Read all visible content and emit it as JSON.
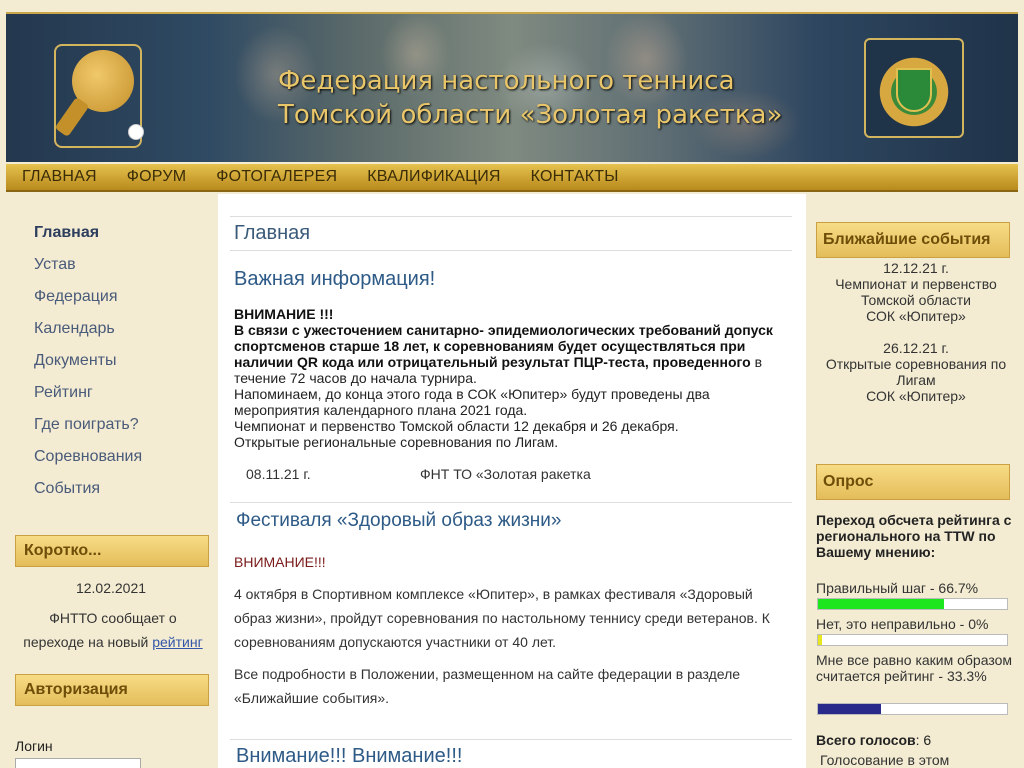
{
  "header": {
    "title_line1": "Федерация настольного тенниса",
    "title_line2": "Томской области «Золотая ракетка»"
  },
  "nav": [
    "ГЛАВНАЯ",
    "ФОРУМ",
    "ФОТОГАЛЕРЕЯ",
    "КВАЛИФИКАЦИЯ",
    "КОНТАКТЫ"
  ],
  "sidebar": {
    "menu": [
      "Главная",
      "Устав",
      "Федерация",
      "Календарь",
      "Документы",
      "Рейтинг",
      "Где поиграть?",
      "Соревнования",
      "События"
    ],
    "short": {
      "heading": "Коротко...",
      "date": "12.02.2021",
      "text": "ФНТТО сообщает о переходе на новый",
      "link": "рейтинг"
    },
    "auth": {
      "heading": "Авторизация",
      "login_label": "Логин"
    }
  },
  "main": {
    "breadcrumb": "Главная",
    "article1": {
      "title": "Важная информация!",
      "attention": "ВНИМАНИЕ !!!",
      "bold_text": " В связи с ужесточением санитарно- эпидемиологических требований допуск спортсменов старше 18 лет, к соревнованиям будет осуществляться при наличии QR кода или отрицательный результат ПЦР-теста, проведенного",
      "rest": " в течение 72 часов до начала турнира.",
      "p2": " Напоминаем, до конца этого года в СОК «Юпитер» будут проведены два мероприятия календарного плана 2021 года.",
      "p3": "Чемпионат и первенство Томской области 12 декабря и 26 декабря.",
      "p4": "Открытые региональные соревнования по Лигам.",
      "date": "08.11.21 г.",
      "org": "ФНТ ТО «Золотая ракетка"
    },
    "article2": {
      "title": "Фестиваля «Здоровый образ жизни»",
      "attention": "ВНИМАНИЕ!!!",
      "p1": "4 октября в Спортивном комплексе «Юпитер», в рамках фестиваля «Здоровый образ жизни», пройдут соревнования по настольному теннису среди ветеранов. К соревнованиям допускаются участники от 40 лет.",
      "p2": "Все подробности в Положении, размещенном на сайте федерации в разделе «Ближайшие события»."
    },
    "article3": {
      "title": "Внимание!!! Внимание!!!"
    }
  },
  "right": {
    "events_heading": "Ближайшие события",
    "events": [
      {
        "date": "12.12.21 г.",
        "name": "Чемпионат и первенство Томской области",
        "place": "СОК «Юпитер»"
      },
      {
        "date": "26.12.21 г.",
        "name": "Открытые соревнования по Лигам",
        "place": "СОК «Юпитер»"
      }
    ],
    "poll": {
      "heading": "Опрос",
      "question": "Переход обсчета рейтинга с регионального на TTW по Вашему мнению:",
      "options": [
        {
          "label": "Правильный шаг - 66.7%",
          "percent": 66.7,
          "color": "#1ee61e"
        },
        {
          "label": "Нет, это неправильно - 0%",
          "percent": 0,
          "color": "#e6e61e"
        },
        {
          "label": "Мне все равно каким образом считается рейтинг - 33.3%",
          "percent": 33.3,
          "color": "#2a2a8a"
        }
      ],
      "total_label": "Всего голосов",
      "total_value": ": 6",
      "note": "Голосование в этом"
    }
  }
}
